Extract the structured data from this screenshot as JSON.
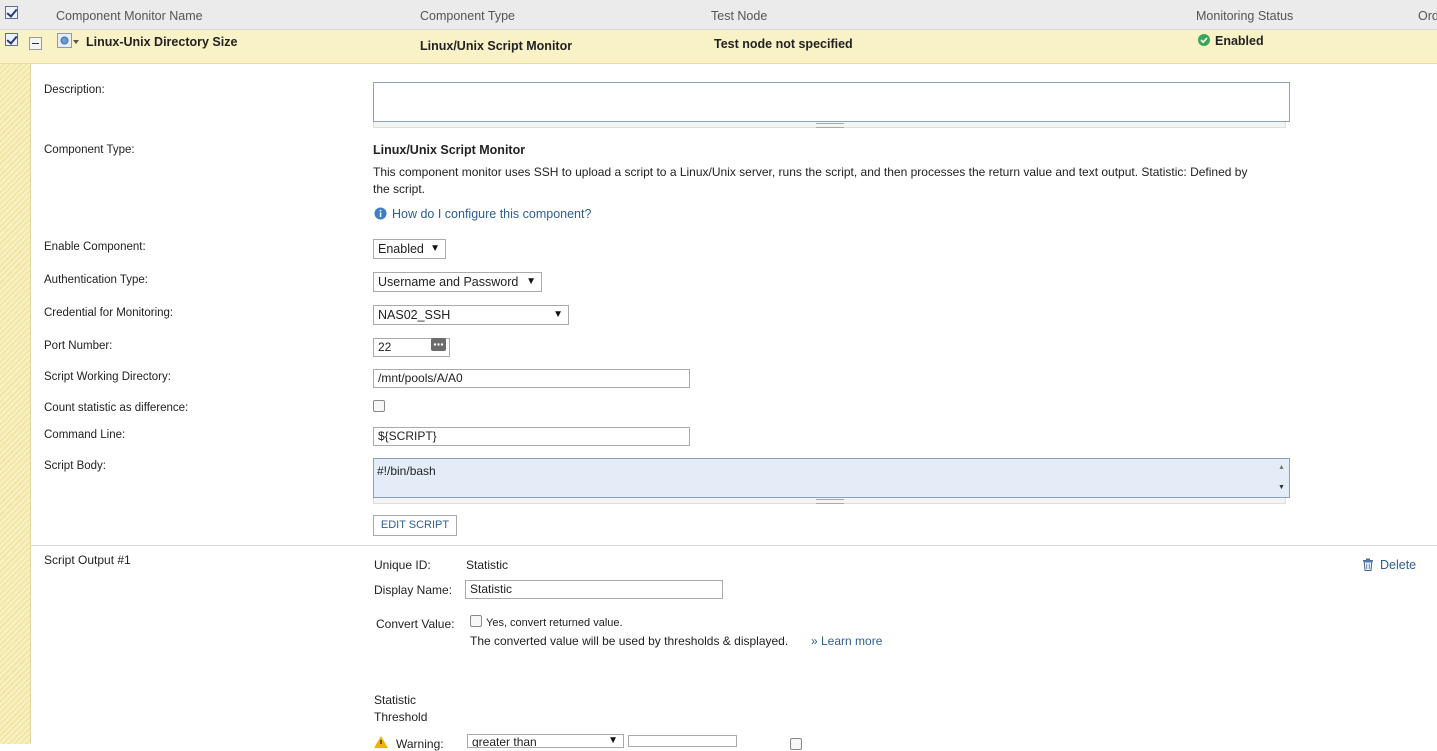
{
  "table_header": {
    "name": "Component Monitor Name",
    "type": "Component Type",
    "test_node": "Test Node",
    "status": "Monitoring Status",
    "order_partial": "Ord"
  },
  "row": {
    "name": "Linux-Unix Directory Size",
    "type": "Linux/Unix Script Monitor",
    "test_node": "Test node not specified",
    "status": "Enabled",
    "status_color": "#3aa655"
  },
  "form": {
    "description": {
      "label": "Description:",
      "value": ""
    },
    "component_type": {
      "label": "Component Type:",
      "value": "Linux/Unix Script Monitor",
      "description_line1": "This component monitor uses SSH to upload a script to a Linux/Unix server, runs the script, and then processes the return value and text output. Statistic: Defined by",
      "description_line2": "the script.",
      "help_link": "How do I configure this component?"
    },
    "enable_component": {
      "label": "Enable Component:",
      "value": "Enabled"
    },
    "auth_type": {
      "label": "Authentication Type:",
      "value": "Username and Password"
    },
    "credential": {
      "label": "Credential for Monitoring:",
      "value": "NAS02_SSH"
    },
    "port": {
      "label": "Port Number:",
      "value": "22"
    },
    "working_dir": {
      "label": "Script Working Directory:",
      "value": "/mnt/pools/A/A0"
    },
    "count_diff": {
      "label": "Count statistic as difference:",
      "checked": false
    },
    "command_line": {
      "label": "Command Line:",
      "value": "${SCRIPT}"
    },
    "script_body": {
      "label": "Script Body:",
      "value": "#!/bin/bash"
    },
    "edit_script": "EDIT SCRIPT"
  },
  "output": {
    "title": "Script Output #1",
    "unique_id_label": "Unique ID:",
    "unique_id_value": "Statistic",
    "display_name_label": "Display Name:",
    "display_name_value": "Statistic",
    "convert_label": "Convert Value:",
    "convert_option": "Yes, convert returned value.",
    "convert_note": "The converted value will be used by thresholds & displayed.",
    "learn_more": "» Learn more",
    "delete": "Delete",
    "threshold_line1": "Statistic",
    "threshold_line2": "Threshold",
    "warning_label": "Warning:",
    "warning_operator": "greater than"
  },
  "colors": {
    "accent_link": "#2f5e93",
    "row_highlight": "#f9f2c6"
  }
}
